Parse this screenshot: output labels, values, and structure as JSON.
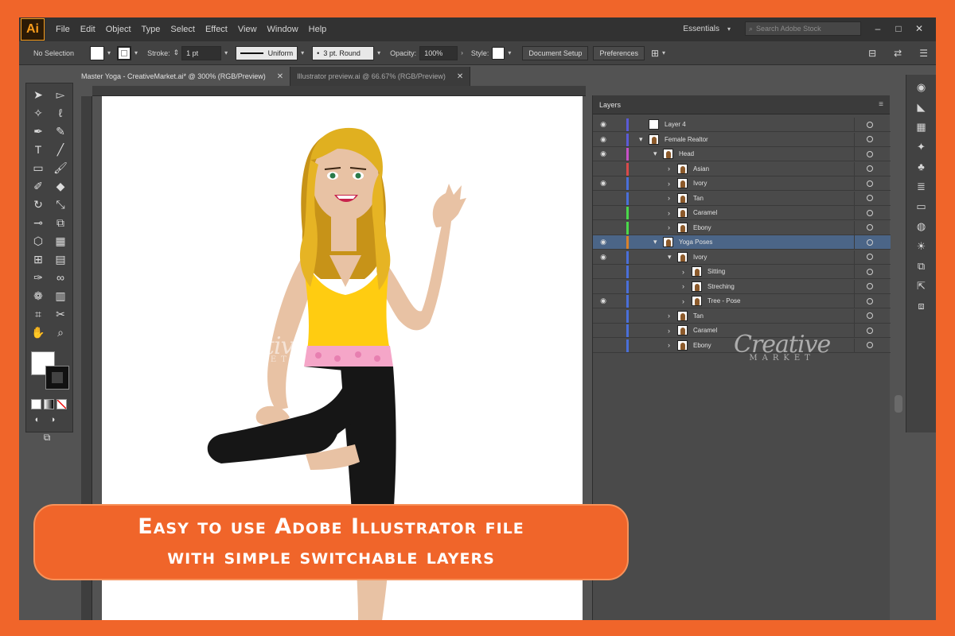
{
  "app": {
    "logo": "Ai",
    "menu": [
      "File",
      "Edit",
      "Object",
      "Type",
      "Select",
      "Effect",
      "View",
      "Window",
      "Help"
    ],
    "workspace": "Essentials",
    "search_placeholder": "Search Adobe Stock"
  },
  "control_bar": {
    "selection": "No Selection",
    "stroke_label": "Stroke:",
    "stroke_value": "1 pt",
    "uniform": "Uniform",
    "brush": "3 pt. Round",
    "opacity_label": "Opacity:",
    "opacity_value": "100%",
    "style_label": "Style:",
    "document_setup": "Document Setup",
    "preferences": "Preferences"
  },
  "tabs": [
    {
      "label": "Master Yoga - CreativeMarket.ai* @ 300% (RGB/Preview)",
      "active": true
    },
    {
      "label": "Illustrator preview.ai @ 66.67% (RGB/Preview)",
      "active": false
    }
  ],
  "layers_panel": {
    "title": "Layers",
    "rows": [
      {
        "name": "Layer 4",
        "visible": true,
        "color": "#5b5bd6",
        "expander": "",
        "selected": false
      },
      {
        "name": "Female Realtor",
        "visible": true,
        "color": "#5b5bd6",
        "expander": "▾",
        "selected": false
      },
      {
        "name": "Head",
        "visible": true,
        "color": "#c84fc8",
        "expander": "▾",
        "selected": false
      },
      {
        "name": "Asian",
        "visible": false,
        "color": "#d94a4a",
        "expander": "›",
        "selected": false
      },
      {
        "name": "Ivory",
        "visible": true,
        "color": "#4a6fd9",
        "expander": "›",
        "selected": false
      },
      {
        "name": "Tan",
        "visible": false,
        "color": "#4a6fd9",
        "expander": "›",
        "selected": false
      },
      {
        "name": "Caramel",
        "visible": false,
        "color": "#4ad94a",
        "expander": "›",
        "selected": false
      },
      {
        "name": "Ebony",
        "visible": false,
        "color": "#4ad94a",
        "expander": "›",
        "selected": false
      },
      {
        "name": "Yoga Poses",
        "visible": true,
        "color": "#d9822b",
        "expander": "▾",
        "selected": true
      },
      {
        "name": "Ivory",
        "visible": true,
        "color": "#4a6fd9",
        "expander": "▾",
        "selected": false
      },
      {
        "name": "Sitting",
        "visible": false,
        "color": "#4a6fd9",
        "expander": "›",
        "selected": false
      },
      {
        "name": "Streching",
        "visible": false,
        "color": "#4a6fd9",
        "expander": "›",
        "selected": false
      },
      {
        "name": "Tree - Pose",
        "visible": true,
        "color": "#4a6fd9",
        "expander": "›",
        "selected": false
      },
      {
        "name": "Tan",
        "visible": false,
        "color": "#4a6fd9",
        "expander": "›",
        "selected": false
      },
      {
        "name": "Caramel",
        "visible": false,
        "color": "#4a6fd9",
        "expander": "›",
        "selected": false
      },
      {
        "name": "Ebony",
        "visible": false,
        "color": "#4a6fd9",
        "expander": "›",
        "selected": false
      }
    ]
  },
  "watermark": {
    "big": "Creative",
    "small": "MARKET"
  },
  "banner": {
    "line1": "Easy to use Adobe Illustrator file",
    "line2": "with simple switchable layers"
  },
  "colors": {
    "accent": "#f0652a",
    "ui_dark": "#323232",
    "selection": "#4b6587"
  }
}
